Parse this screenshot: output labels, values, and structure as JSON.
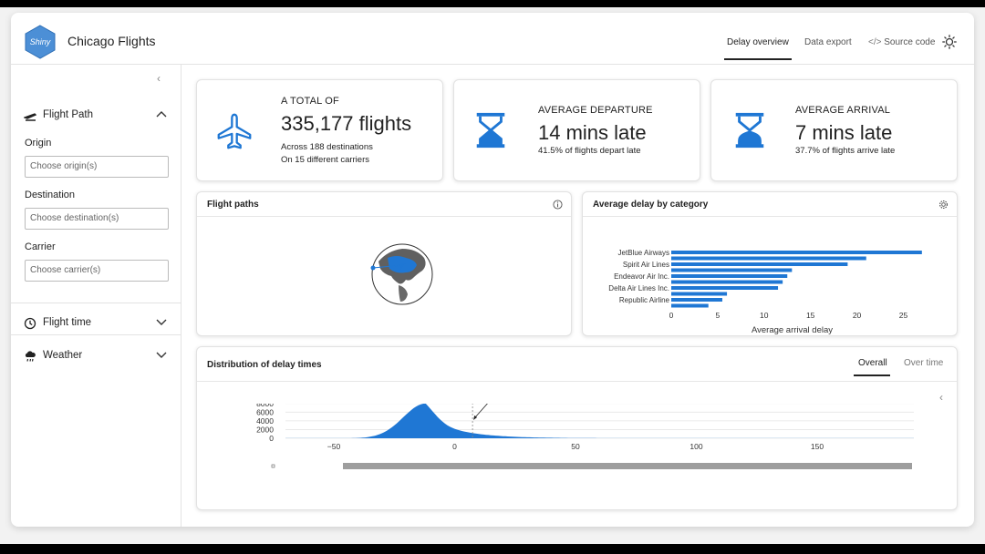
{
  "app": {
    "title": "Chicago Flights",
    "logo_text": "Shiny"
  },
  "nav": {
    "tabs": [
      "Delay overview",
      "Data export",
      "Source code"
    ],
    "active": "Delay overview"
  },
  "sidebar": {
    "flight_path": {
      "label": "Flight Path",
      "origin_label": "Origin",
      "origin_placeholder": "Choose origin(s)",
      "destination_label": "Destination",
      "destination_placeholder": "Choose destination(s)",
      "carrier_label": "Carrier",
      "carrier_placeholder": "Choose carrier(s)"
    },
    "flight_time_label": "Flight time",
    "weather_label": "Weather"
  },
  "value_boxes": {
    "total": {
      "label": "A TOTAL OF",
      "value": "335,177 flights",
      "sub1": "Across 188 destinations",
      "sub2": "On 15 different carriers"
    },
    "departure": {
      "label": "AVERAGE DEPARTURE",
      "value": "14 mins late",
      "sub1": "41.5% of flights depart late"
    },
    "arrival": {
      "label": "AVERAGE ARRIVAL",
      "value": "7 mins late",
      "sub1": "37.7% of flights arrive late"
    }
  },
  "cards": {
    "flight_paths_title": "Flight paths",
    "avg_delay_title": "Average delay by category",
    "distribution_title": "Distribution of delay times",
    "distribution_tabs": [
      "Overall",
      "Over time"
    ]
  },
  "colors": {
    "accent": "#1f77d4",
    "text": "#222222",
    "border": "#e2e2e2"
  },
  "chart_data": [
    {
      "type": "bar",
      "orientation": "horizontal",
      "categories": [
        "JetBlue Airways",
        "",
        "Spirit Air Lines",
        "",
        "Endeavor Air Inc.",
        "",
        "Delta Air Lines Inc.",
        "",
        "Republic Airline",
        ""
      ],
      "values": [
        27,
        21,
        19,
        13,
        12.5,
        12,
        11.5,
        6,
        5.5,
        4
      ],
      "xticks": [
        0,
        5,
        10,
        15,
        20,
        25
      ],
      "xlabel": "Average arrival delay",
      "xlim": [
        0,
        28
      ]
    },
    {
      "type": "area",
      "xticks": [
        -50,
        0,
        50,
        100,
        150
      ],
      "yticks": [
        0,
        2000,
        4000,
        6000,
        8000
      ],
      "xlim": [
        -70,
        190
      ],
      "ylim": [
        0,
        9000
      ],
      "annotation": {
        "text": "delay of 7.4 min",
        "x": 7.4
      },
      "peak": {
        "x": -12,
        "y": 8000
      }
    }
  ]
}
